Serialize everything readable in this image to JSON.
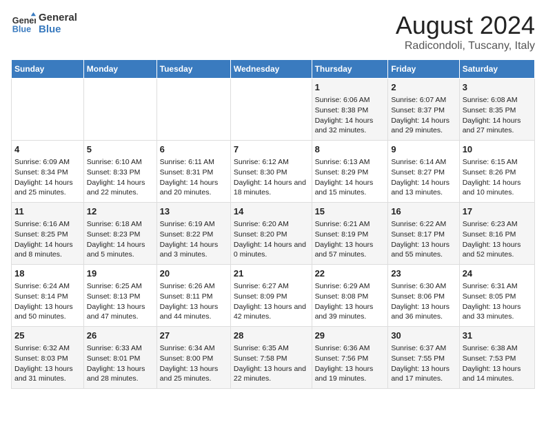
{
  "logo": {
    "line1": "General",
    "line2": "Blue"
  },
  "title": "August 2024",
  "subtitle": "Radicondoli, Tuscany, Italy",
  "days_of_week": [
    "Sunday",
    "Monday",
    "Tuesday",
    "Wednesday",
    "Thursday",
    "Friday",
    "Saturday"
  ],
  "weeks": [
    [
      {
        "day": "",
        "info": ""
      },
      {
        "day": "",
        "info": ""
      },
      {
        "day": "",
        "info": ""
      },
      {
        "day": "",
        "info": ""
      },
      {
        "day": "1",
        "info": "Sunrise: 6:06 AM\nSunset: 8:38 PM\nDaylight: 14 hours and 32 minutes."
      },
      {
        "day": "2",
        "info": "Sunrise: 6:07 AM\nSunset: 8:37 PM\nDaylight: 14 hours and 29 minutes."
      },
      {
        "day": "3",
        "info": "Sunrise: 6:08 AM\nSunset: 8:35 PM\nDaylight: 14 hours and 27 minutes."
      }
    ],
    [
      {
        "day": "4",
        "info": "Sunrise: 6:09 AM\nSunset: 8:34 PM\nDaylight: 14 hours and 25 minutes."
      },
      {
        "day": "5",
        "info": "Sunrise: 6:10 AM\nSunset: 8:33 PM\nDaylight: 14 hours and 22 minutes."
      },
      {
        "day": "6",
        "info": "Sunrise: 6:11 AM\nSunset: 8:31 PM\nDaylight: 14 hours and 20 minutes."
      },
      {
        "day": "7",
        "info": "Sunrise: 6:12 AM\nSunset: 8:30 PM\nDaylight: 14 hours and 18 minutes."
      },
      {
        "day": "8",
        "info": "Sunrise: 6:13 AM\nSunset: 8:29 PM\nDaylight: 14 hours and 15 minutes."
      },
      {
        "day": "9",
        "info": "Sunrise: 6:14 AM\nSunset: 8:27 PM\nDaylight: 14 hours and 13 minutes."
      },
      {
        "day": "10",
        "info": "Sunrise: 6:15 AM\nSunset: 8:26 PM\nDaylight: 14 hours and 10 minutes."
      }
    ],
    [
      {
        "day": "11",
        "info": "Sunrise: 6:16 AM\nSunset: 8:25 PM\nDaylight: 14 hours and 8 minutes."
      },
      {
        "day": "12",
        "info": "Sunrise: 6:18 AM\nSunset: 8:23 PM\nDaylight: 14 hours and 5 minutes."
      },
      {
        "day": "13",
        "info": "Sunrise: 6:19 AM\nSunset: 8:22 PM\nDaylight: 14 hours and 3 minutes."
      },
      {
        "day": "14",
        "info": "Sunrise: 6:20 AM\nSunset: 8:20 PM\nDaylight: 14 hours and 0 minutes."
      },
      {
        "day": "15",
        "info": "Sunrise: 6:21 AM\nSunset: 8:19 PM\nDaylight: 13 hours and 57 minutes."
      },
      {
        "day": "16",
        "info": "Sunrise: 6:22 AM\nSunset: 8:17 PM\nDaylight: 13 hours and 55 minutes."
      },
      {
        "day": "17",
        "info": "Sunrise: 6:23 AM\nSunset: 8:16 PM\nDaylight: 13 hours and 52 minutes."
      }
    ],
    [
      {
        "day": "18",
        "info": "Sunrise: 6:24 AM\nSunset: 8:14 PM\nDaylight: 13 hours and 50 minutes."
      },
      {
        "day": "19",
        "info": "Sunrise: 6:25 AM\nSunset: 8:13 PM\nDaylight: 13 hours and 47 minutes."
      },
      {
        "day": "20",
        "info": "Sunrise: 6:26 AM\nSunset: 8:11 PM\nDaylight: 13 hours and 44 minutes."
      },
      {
        "day": "21",
        "info": "Sunrise: 6:27 AM\nSunset: 8:09 PM\nDaylight: 13 hours and 42 minutes."
      },
      {
        "day": "22",
        "info": "Sunrise: 6:29 AM\nSunset: 8:08 PM\nDaylight: 13 hours and 39 minutes."
      },
      {
        "day": "23",
        "info": "Sunrise: 6:30 AM\nSunset: 8:06 PM\nDaylight: 13 hours and 36 minutes."
      },
      {
        "day": "24",
        "info": "Sunrise: 6:31 AM\nSunset: 8:05 PM\nDaylight: 13 hours and 33 minutes."
      }
    ],
    [
      {
        "day": "25",
        "info": "Sunrise: 6:32 AM\nSunset: 8:03 PM\nDaylight: 13 hours and 31 minutes."
      },
      {
        "day": "26",
        "info": "Sunrise: 6:33 AM\nSunset: 8:01 PM\nDaylight: 13 hours and 28 minutes."
      },
      {
        "day": "27",
        "info": "Sunrise: 6:34 AM\nSunset: 8:00 PM\nDaylight: 13 hours and 25 minutes."
      },
      {
        "day": "28",
        "info": "Sunrise: 6:35 AM\nSunset: 7:58 PM\nDaylight: 13 hours and 22 minutes."
      },
      {
        "day": "29",
        "info": "Sunrise: 6:36 AM\nSunset: 7:56 PM\nDaylight: 13 hours and 19 minutes."
      },
      {
        "day": "30",
        "info": "Sunrise: 6:37 AM\nSunset: 7:55 PM\nDaylight: 13 hours and 17 minutes."
      },
      {
        "day": "31",
        "info": "Sunrise: 6:38 AM\nSunset: 7:53 PM\nDaylight: 13 hours and 14 minutes."
      }
    ]
  ]
}
